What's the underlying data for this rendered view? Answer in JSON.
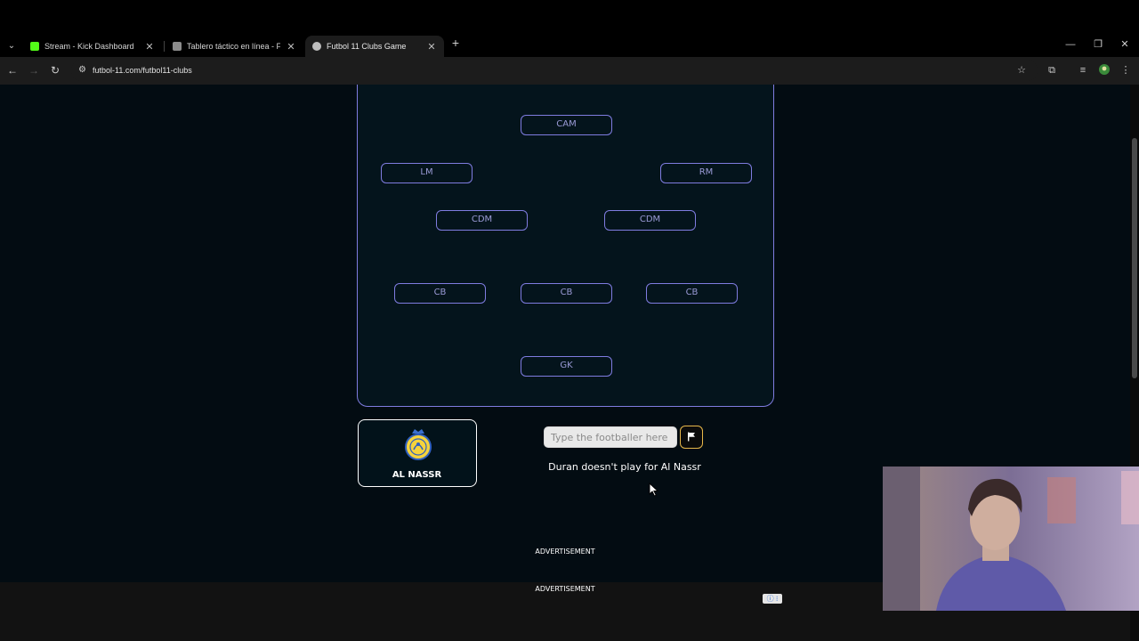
{
  "browser": {
    "tabs": [
      {
        "title": "Stream - Kick Dashboard",
        "favicon_color": "#53fc18",
        "active": false
      },
      {
        "title": "Tablero táctico en línea - Fútbol",
        "favicon_color": "#8c8c8c",
        "active": false
      },
      {
        "title": "Futbol 11 Clubs Game",
        "favicon_color": "#bdbdbd",
        "active": true
      }
    ],
    "url": "futbol-11.com/futbol11-clubs"
  },
  "pitch": {
    "positions": [
      "CAM",
      "LM",
      "RM",
      "CDM",
      "CDM",
      "CB",
      "CB",
      "CB",
      "GK"
    ]
  },
  "club": {
    "name": "AL NASSR",
    "logo_color": "#f5d33c"
  },
  "guess": {
    "placeholder": "Type the footballer here",
    "feedback": "Duran doesn't play for Al Nassr"
  },
  "ads": {
    "label_top": "ADVERTISEMENT",
    "label_bottom": "ADVERTISEMENT"
  },
  "theme": {
    "accent": "#7f7ce0",
    "flag_border": "#e8b84a"
  }
}
